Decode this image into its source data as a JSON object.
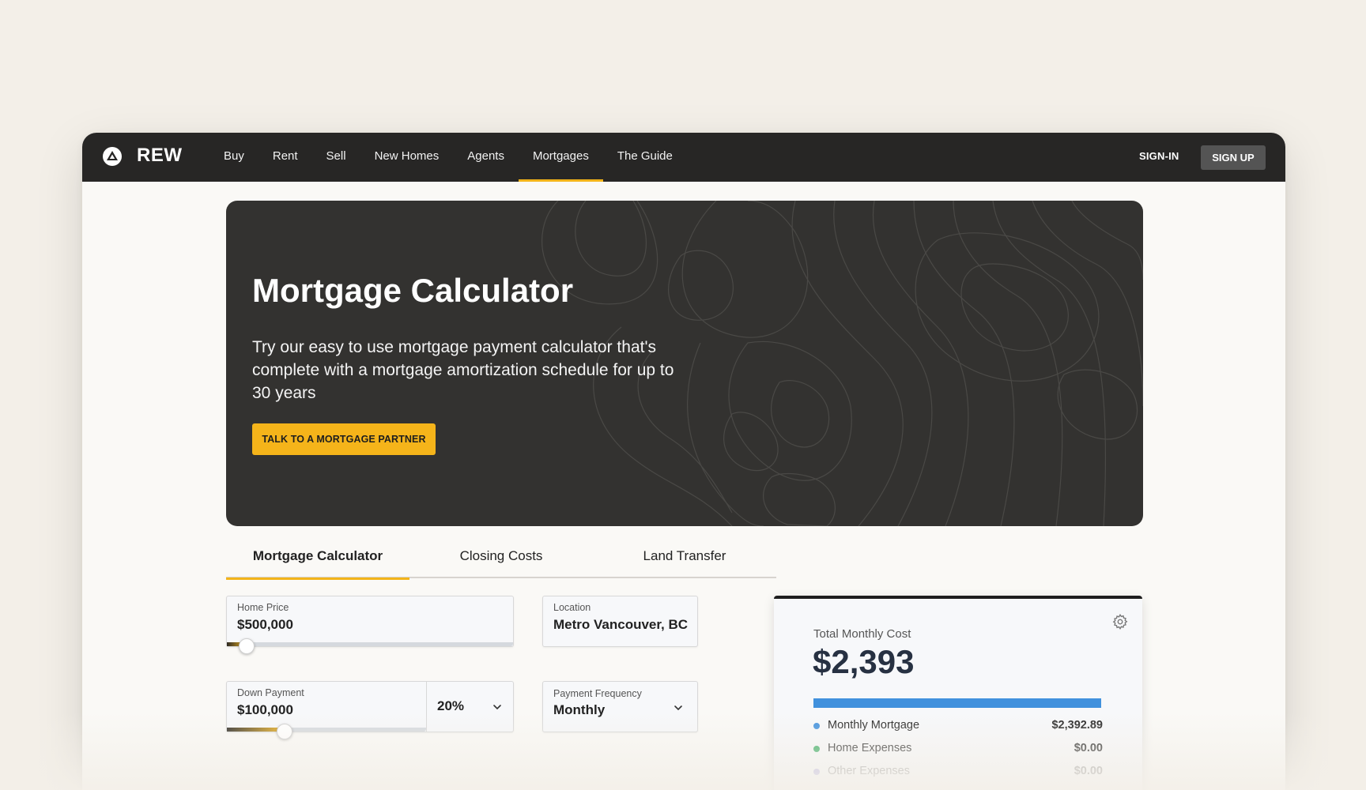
{
  "nav": {
    "brand": "REW",
    "links": [
      {
        "label": "Buy"
      },
      {
        "label": "Rent"
      },
      {
        "label": "Sell"
      },
      {
        "label": "New Homes"
      },
      {
        "label": "Agents"
      },
      {
        "label": "Mortgages",
        "active": true
      },
      {
        "label": "The Guide"
      }
    ],
    "signin_label": "SIGN-IN",
    "signup_label": "SIGN UP"
  },
  "hero": {
    "title": "Mortgage Calculator",
    "subtitle": "Try our easy to use mortgage payment calculator that's complete with a mortgage amortization schedule for up to 30 years",
    "cta_label": "TALK TO A MORTGAGE PARTNER"
  },
  "tabs": [
    {
      "label": "Mortgage Calculator",
      "active": true
    },
    {
      "label": "Closing Costs"
    },
    {
      "label": "Land Transfer"
    }
  ],
  "form": {
    "home_price": {
      "label": "Home Price",
      "value": "$500,000",
      "slider_fraction": 0.07
    },
    "location": {
      "label": "Location",
      "value": "Metro Vancouver, BC"
    },
    "down_payment": {
      "label": "Down Payment",
      "value": "$100,000",
      "percent": "20%",
      "slider_fraction": 0.2
    },
    "payment_frequency": {
      "label": "Payment Frequency",
      "value": "Monthly"
    }
  },
  "summary": {
    "label": "Total Monthly Cost",
    "total": "$2,393",
    "bar_fraction": 1.0,
    "items": [
      {
        "name": "Monthly Mortgage",
        "amount": "$2,392.89",
        "color": "#4191dd"
      },
      {
        "name": "Home Expenses",
        "amount": "$0.00",
        "color": "#2fa85a"
      },
      {
        "name": "Other Expenses",
        "amount": "$0.00",
        "color": "#b7b3e0"
      }
    ]
  },
  "colors": {
    "accent": "#f3b419",
    "navbar": "#272625",
    "hero_bg": "#333230",
    "total_bar": "#4191dd"
  }
}
